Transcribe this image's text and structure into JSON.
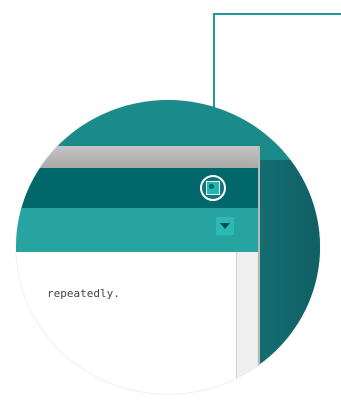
{
  "colors": {
    "accent": "#1e9a9a",
    "toolbar": "#00686b",
    "tabbar": "#27a4a1",
    "titlebar": "#b9b9b9",
    "editor_bg": "#ffffff"
  },
  "toolbar": {
    "serial_monitor_button": {
      "icon": "magnifier-icon"
    }
  },
  "tabbar": {
    "menu_button_icon": "triangle-down-icon"
  },
  "editor": {
    "visible_text": "repeatedly."
  }
}
